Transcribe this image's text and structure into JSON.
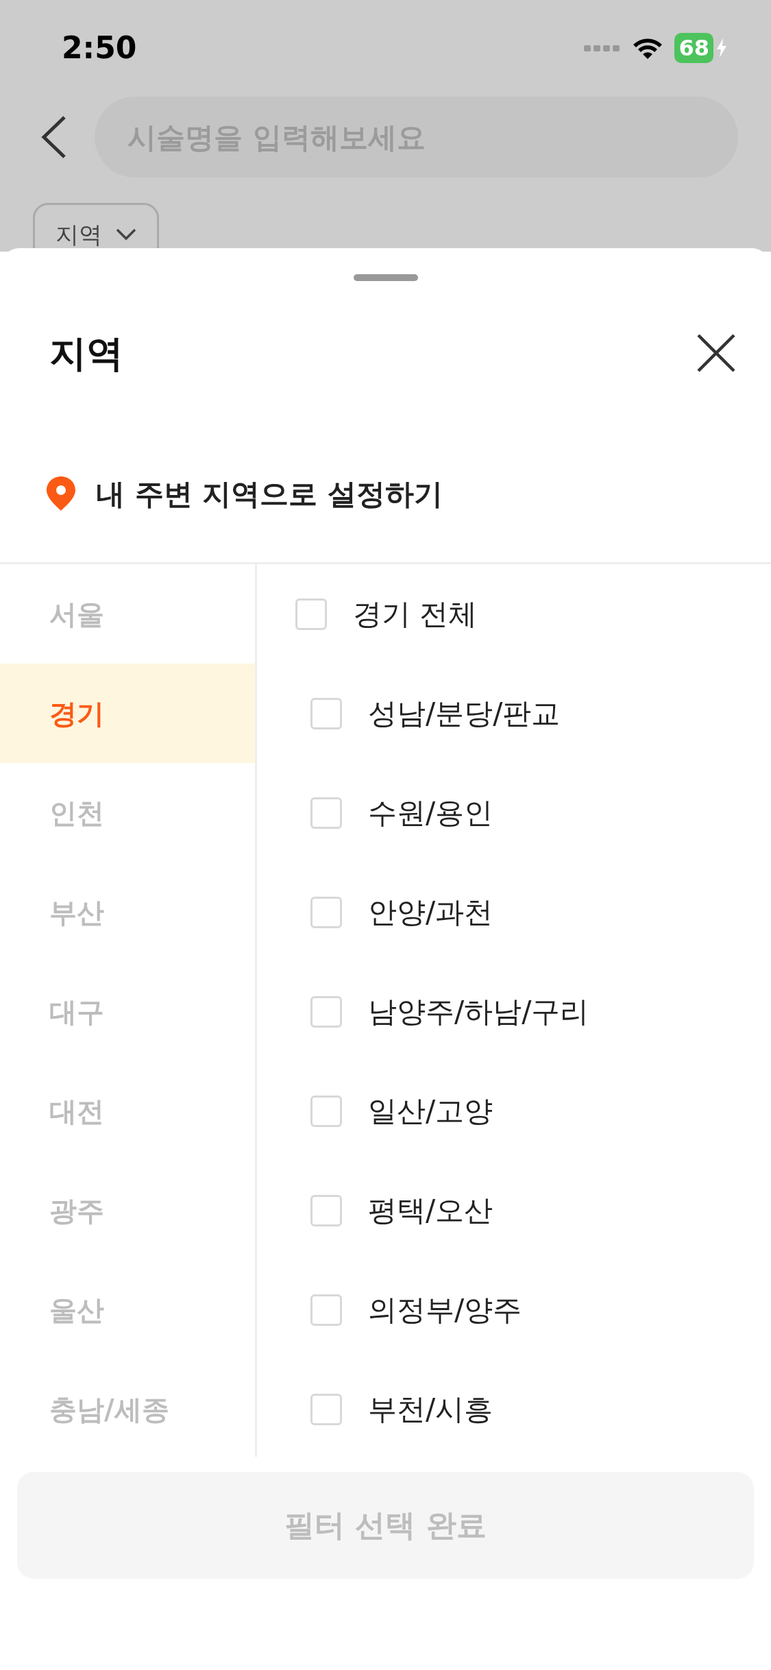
{
  "status_bar": {
    "time": "2:50",
    "battery": "68",
    "charging": true
  },
  "search": {
    "placeholder": "시술명을 입력해보세요"
  },
  "filter_chip": {
    "label": "지역"
  },
  "sheet": {
    "title": "지역",
    "nearby": "내 주변 지역으로 설정하기",
    "regions": [
      {
        "label": "서울",
        "selected": false
      },
      {
        "label": "경기",
        "selected": true
      },
      {
        "label": "인천",
        "selected": false
      },
      {
        "label": "부산",
        "selected": false
      },
      {
        "label": "대구",
        "selected": false
      },
      {
        "label": "대전",
        "selected": false
      },
      {
        "label": "광주",
        "selected": false
      },
      {
        "label": "울산",
        "selected": false
      },
      {
        "label": "충남/세종",
        "selected": false
      }
    ],
    "districts": [
      {
        "kind": "all",
        "label": "경기 전체",
        "checked": false
      },
      {
        "kind": "item",
        "label": "성남/분당/판교",
        "checked": false
      },
      {
        "kind": "item",
        "label": "수원/용인",
        "checked": false
      },
      {
        "kind": "item",
        "label": "안양/과천",
        "checked": false
      },
      {
        "kind": "item",
        "label": "남양주/하남/구리",
        "checked": false
      },
      {
        "kind": "item",
        "label": "일산/고양",
        "checked": false
      },
      {
        "kind": "item",
        "label": "평택/오산",
        "checked": false
      },
      {
        "kind": "item",
        "label": "의정부/양주",
        "checked": false
      },
      {
        "kind": "item",
        "label": "부천/시흥",
        "checked": false
      }
    ],
    "submit": {
      "label": "필터 선택 완료",
      "disabled": true
    }
  }
}
